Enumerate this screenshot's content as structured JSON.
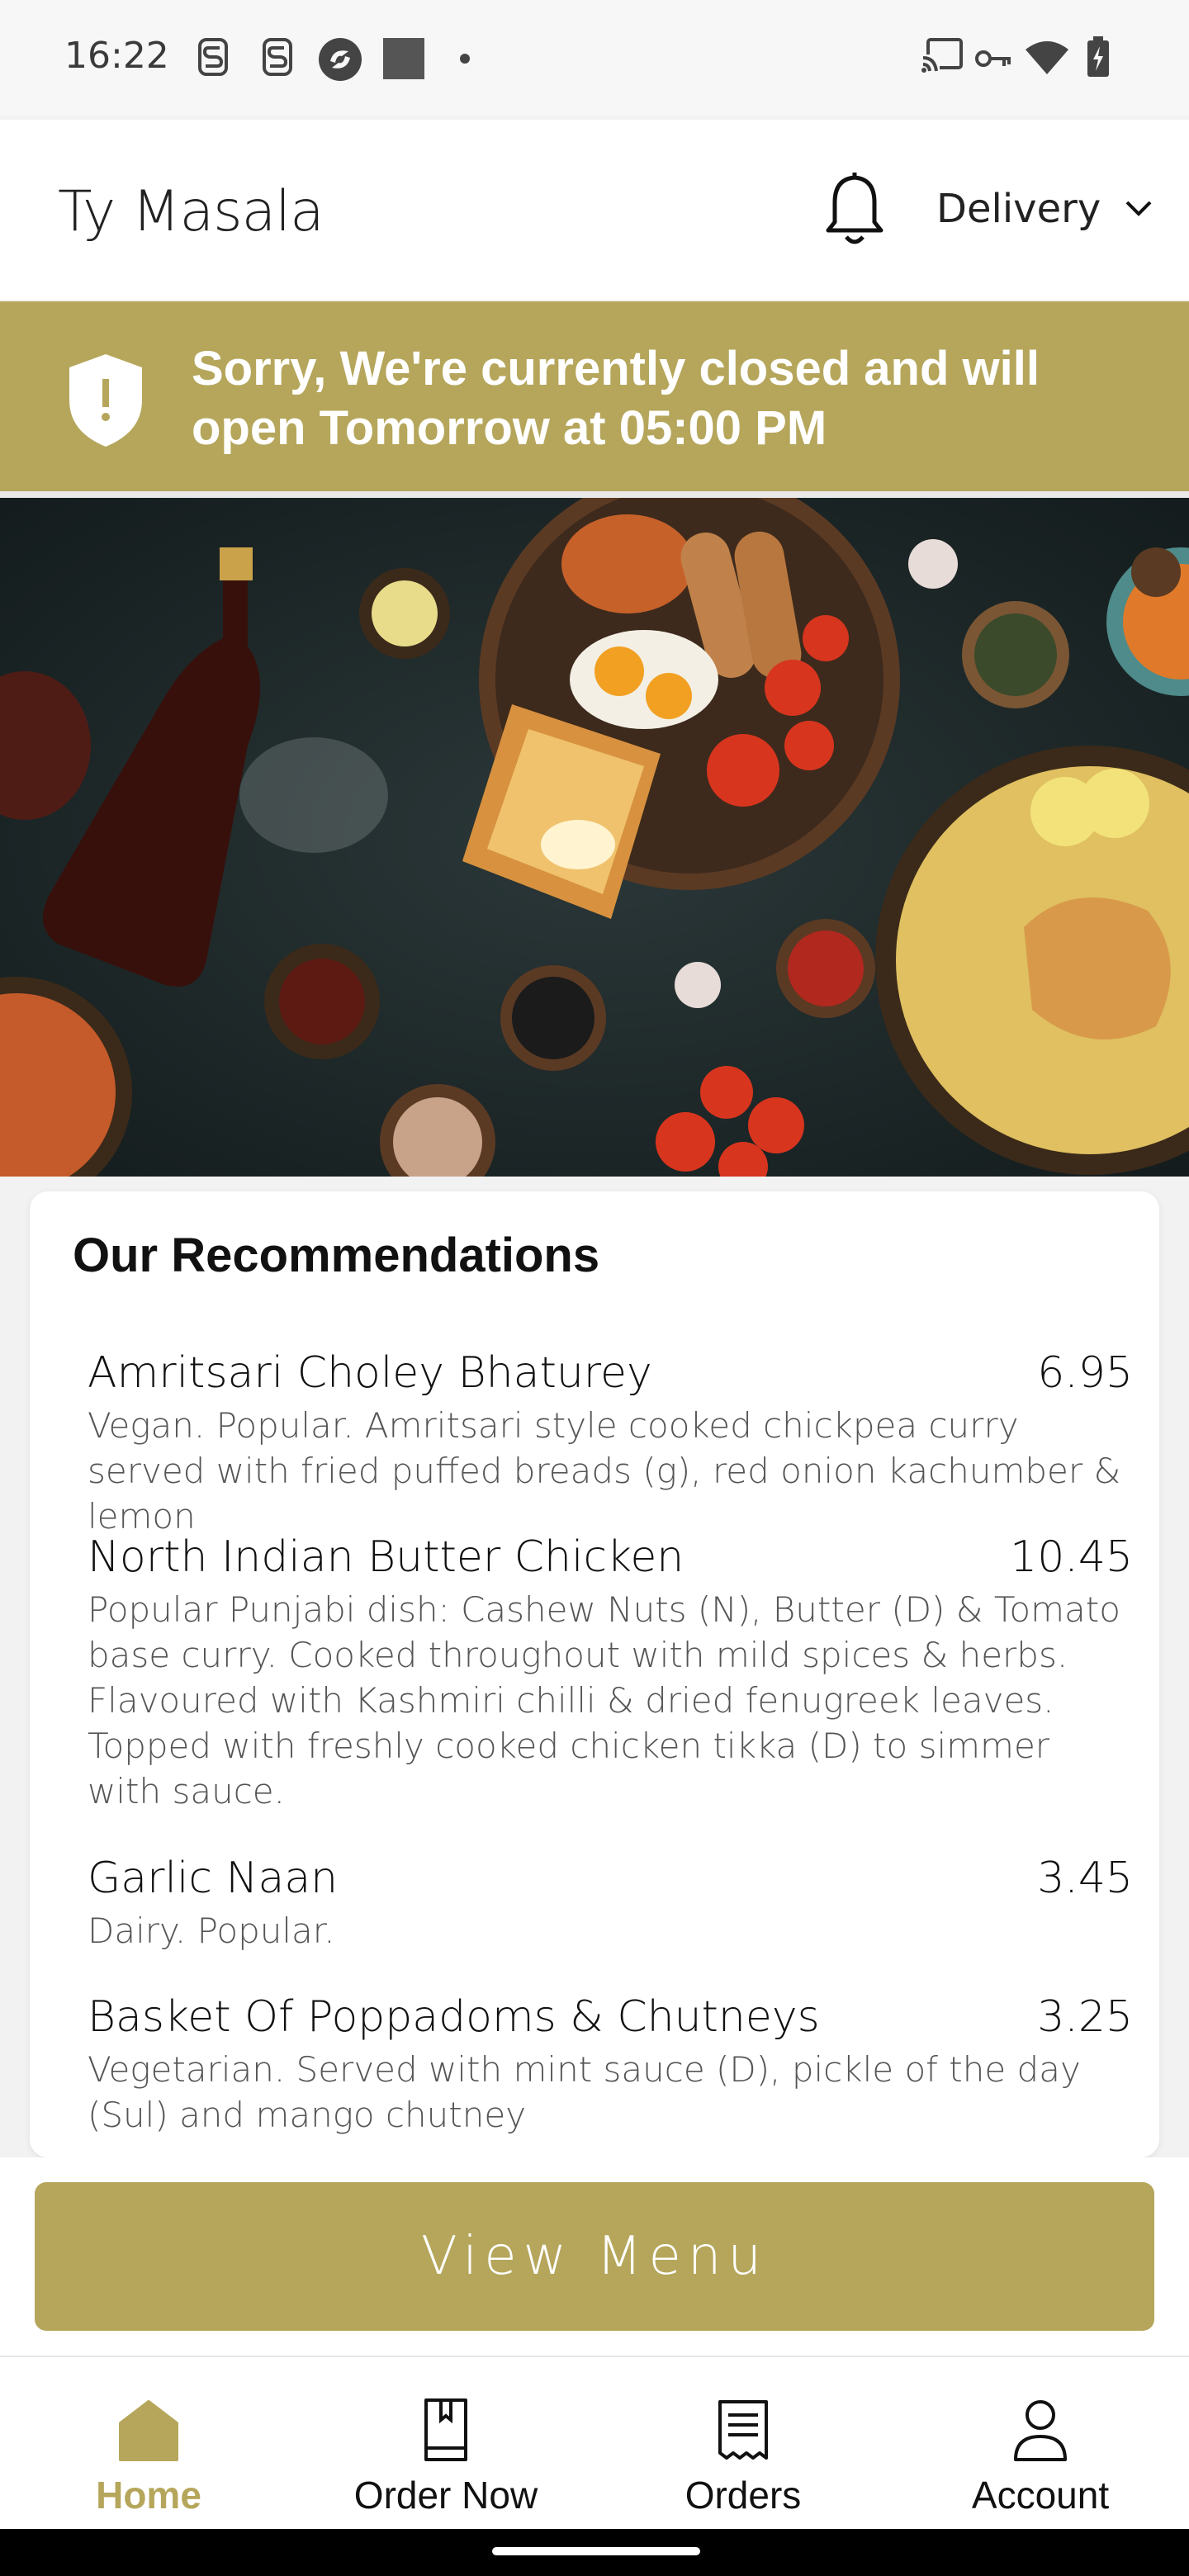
{
  "status_bar": {
    "time": "16:22",
    "icons": [
      "notification-s-icon",
      "notification-s-icon",
      "app-circle-icon",
      "app-square-icon",
      "dot-icon",
      "cast-icon",
      "vpn-key-icon",
      "wifi-icon",
      "battery-charging-icon"
    ]
  },
  "header": {
    "title": "Ty Masala",
    "notification_icon": "bell-icon",
    "delivery_label": "Delivery",
    "dropdown_icon": "chevron-down-icon"
  },
  "banner": {
    "icon": "shield-alert-icon",
    "message": "Sorry, We're currently closed and will open Tomorrow at 05:00 PM"
  },
  "hero": {
    "description_icon": "food-spread-image"
  },
  "recommendations": {
    "title": "Our Recommendations",
    "items": [
      {
        "name": "Amritsari Choley Bhaturey",
        "price": "6.95",
        "description": "Vegan. Popular. Amritsari style cooked chickpea curry served with fried puffed breads (g), red onion kachumber & lemon"
      },
      {
        "name": "North Indian Butter Chicken",
        "price": "10.45",
        "description": "Popular Punjabi dish: Cashew Nuts (N), Butter (D) & Tomato base curry. Cooked throughout with mild spices & herbs. Flavoured with Kashmiri chilli & dried fenugreek leaves. Topped with freshly cooked chicken tikka (D) to simmer with sauce."
      },
      {
        "name": "Garlic Naan",
        "price": "3.45",
        "description": "Dairy. Popular."
      },
      {
        "name": "Basket Of Poppadoms & Chutneys",
        "price": "3.25",
        "description": "Vegetarian. Served with mint sauce (D), pickle of the day (Sul) and mango chutney"
      }
    ]
  },
  "view_menu_label": "View Menu",
  "bottom_nav": {
    "items": [
      {
        "label": "Home",
        "icon": "home-icon",
        "active": true
      },
      {
        "label": "Order Now",
        "icon": "book-icon",
        "active": false
      },
      {
        "label": "Orders",
        "icon": "receipt-icon",
        "active": false
      },
      {
        "label": "Account",
        "icon": "person-icon",
        "active": false
      }
    ]
  },
  "colors": {
    "accent": "#b5a65b",
    "header_bg": "#ffffff",
    "status_bg": "#f7f7f7",
    "text": "#111111"
  }
}
